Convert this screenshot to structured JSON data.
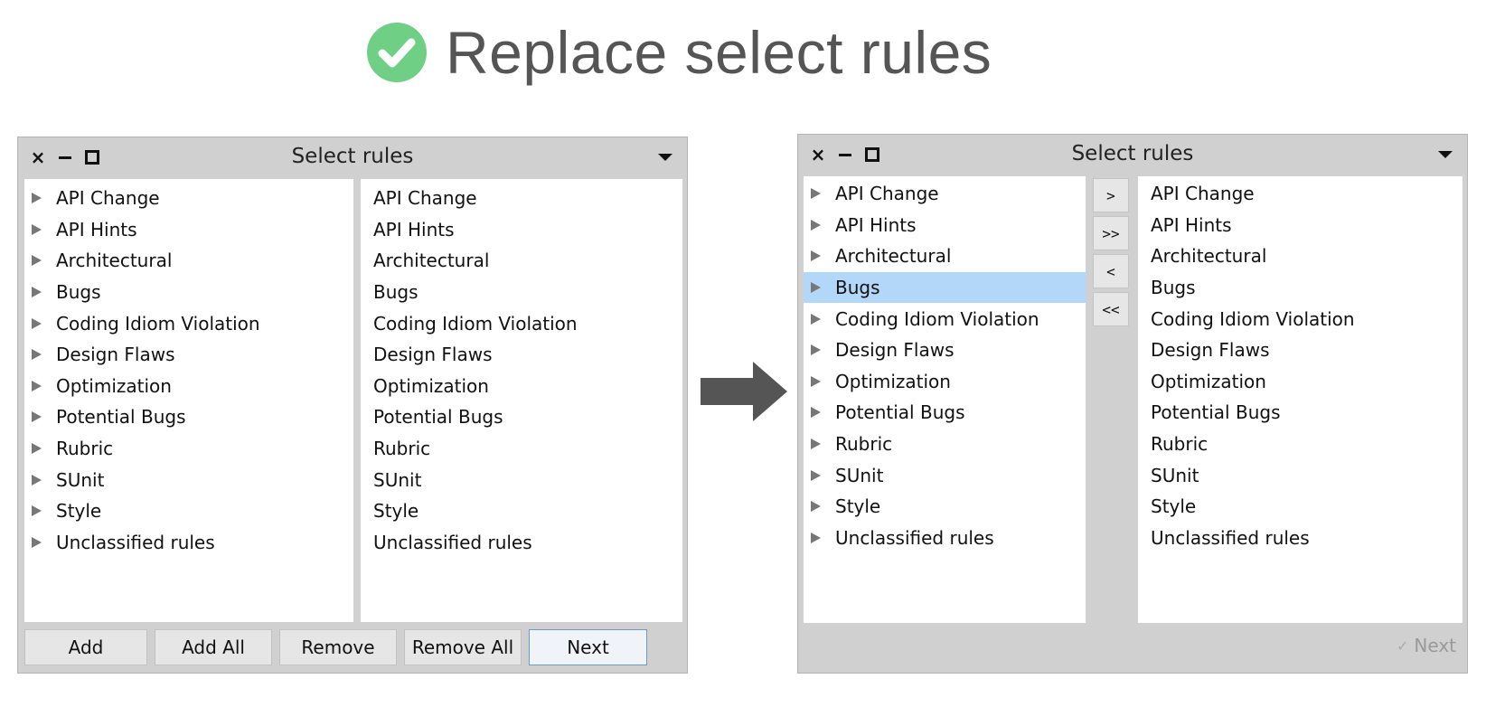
{
  "slide": {
    "title": "Replace select rules"
  },
  "colors": {
    "check": "#6fcf84",
    "title_text": "#555555",
    "selection": "#b3d7f8",
    "arrow": "#555555"
  },
  "left_window": {
    "title": "Select rules",
    "available": [
      "API Change",
      "API Hints",
      "Architectural",
      "Bugs",
      "Coding Idiom Violation",
      "Design Flaws",
      "Optimization",
      "Potential Bugs",
      "Rubric",
      "SUnit",
      "Style",
      "Unclassified rules"
    ],
    "selected": [
      "API Change",
      "API Hints",
      "Architectural",
      "Bugs",
      "Coding Idiom Violation",
      "Design Flaws",
      "Optimization",
      "Potential Bugs",
      "Rubric",
      "SUnit",
      "Style",
      "Unclassified rules"
    ],
    "buttons": {
      "add": "Add",
      "add_all": "Add All",
      "remove": "Remove",
      "remove_all": "Remove All",
      "next": "Next"
    }
  },
  "right_window": {
    "title": "Select rules",
    "available": [
      "API Change",
      "API Hints",
      "Architectural",
      "Bugs",
      "Coding Idiom Violation",
      "Design Flaws",
      "Optimization",
      "Potential Bugs",
      "Rubric",
      "SUnit",
      "Style",
      "Unclassified rules"
    ],
    "highlighted_index": 3,
    "selected": [
      "API Change",
      "API Hints",
      "Architectural",
      "Bugs",
      "Coding Idiom Violation",
      "Design Flaws",
      "Optimization",
      "Potential Bugs",
      "Rubric",
      "SUnit",
      "Style",
      "Unclassified rules"
    ],
    "move_buttons": {
      "add_one": ">",
      "add_all": ">>",
      "remove_one": "<",
      "remove_all": "<<"
    },
    "next": "Next"
  }
}
